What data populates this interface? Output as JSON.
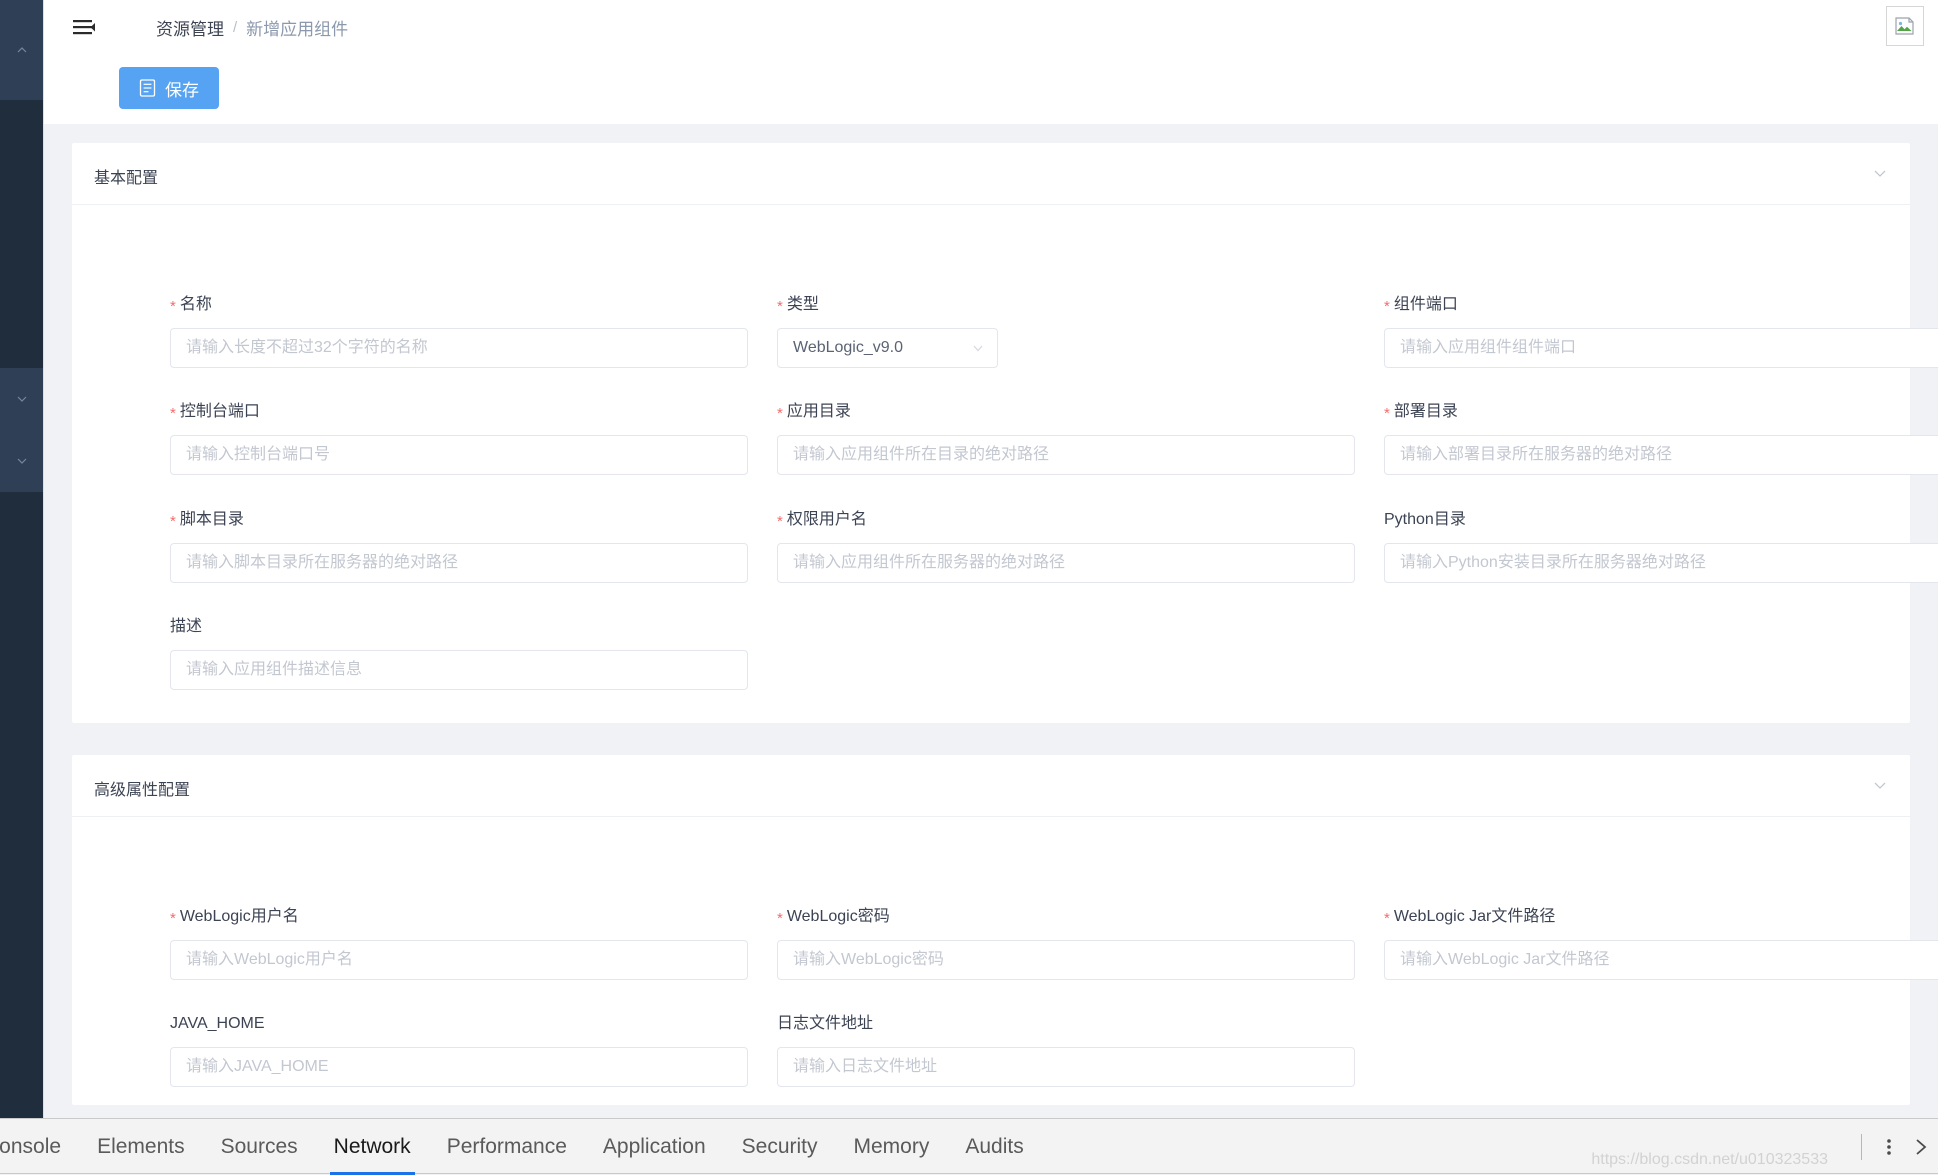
{
  "header": {
    "menu_icon": "hamburger-icon",
    "breadcrumb": {
      "root": "资源管理",
      "separator": "/",
      "current": "新增应用组件"
    },
    "save_label": "保存",
    "save_icon": "document-icon",
    "accent_color": "#57a3f3",
    "avatar_icon": "broken-image-icon"
  },
  "sidebar": {
    "background_color": "#1f2d3d",
    "items": [
      {
        "name": "sidebar-chevron-up",
        "icon": "chevron-up-icon"
      },
      {
        "name": "sidebar-chevron-down-1",
        "icon": "chevron-down-icon"
      },
      {
        "name": "sidebar-chevron-down-2",
        "icon": "chevron-down-icon"
      }
    ]
  },
  "sections": {
    "basic": {
      "title": "基本配置",
      "collapse_icon": "chevron-down-icon",
      "fields": {
        "name": {
          "label": "名称",
          "required": true,
          "placeholder": "请输入长度不超过32个字符的名称",
          "value": ""
        },
        "type": {
          "label": "类型",
          "required": true,
          "value": "WebLogic_v9.0",
          "caret_icon": "chevron-down-icon"
        },
        "component_port": {
          "label": "组件端口",
          "required": true,
          "placeholder": "请输入应用组件组件端口",
          "value": ""
        },
        "console_port": {
          "label": "控制台端口",
          "required": true,
          "placeholder": "请输入控制台端口号",
          "value": ""
        },
        "app_dir": {
          "label": "应用目录",
          "required": true,
          "placeholder": "请输入应用组件所在目录的绝对路径",
          "value": ""
        },
        "deploy_dir": {
          "label": "部署目录",
          "required": true,
          "placeholder": "请输入部署目录所在服务器的绝对路径",
          "value": ""
        },
        "script_dir": {
          "label": "脚本目录",
          "required": true,
          "placeholder": "请输入脚本目录所在服务器的绝对路径",
          "value": ""
        },
        "priv_user": {
          "label": "权限用户名",
          "required": true,
          "placeholder": "请输入应用组件所在服务器的绝对路径",
          "value": ""
        },
        "python_dir": {
          "label": "Python目录",
          "required": false,
          "placeholder": "请输入Python安装目录所在服务器绝对路径",
          "value": ""
        },
        "description": {
          "label": "描述",
          "required": false,
          "placeholder": "请输入应用组件描述信息",
          "value": ""
        }
      }
    },
    "advanced": {
      "title": "高级属性配置",
      "collapse_icon": "chevron-down-icon",
      "fields": {
        "wl_user": {
          "label": "WebLogic用户名",
          "required": true,
          "placeholder": "请输入WebLogic用户名",
          "value": ""
        },
        "wl_password": {
          "label": "WebLogic密码",
          "required": true,
          "placeholder": "请输入WebLogic密码",
          "value": ""
        },
        "wl_jar_path": {
          "label": "WebLogic Jar文件路径",
          "required": true,
          "placeholder": "请输入WebLogic Jar文件路径",
          "value": ""
        },
        "java_home": {
          "label": "JAVA_HOME",
          "required": false,
          "placeholder": "请输入JAVA_HOME",
          "value": ""
        },
        "log_path": {
          "label": "日志文件地址",
          "required": false,
          "placeholder": "请输入日志文件地址",
          "value": ""
        }
      }
    }
  },
  "devtools": {
    "tabs": [
      {
        "label": "Console",
        "active": false
      },
      {
        "label": "Elements",
        "active": false
      },
      {
        "label": "Sources",
        "active": false
      },
      {
        "label": "Network",
        "active": true
      },
      {
        "label": "Performance",
        "active": false
      },
      {
        "label": "Application",
        "active": false
      },
      {
        "label": "Security",
        "active": false
      },
      {
        "label": "Memory",
        "active": false
      },
      {
        "label": "Audits",
        "active": false
      }
    ],
    "active_tab_color": "#1a73e8",
    "more_icon": "kebab-menu-icon",
    "close_icon": "close-icon"
  },
  "watermark": "https://blog.csdn.net/u010323533"
}
